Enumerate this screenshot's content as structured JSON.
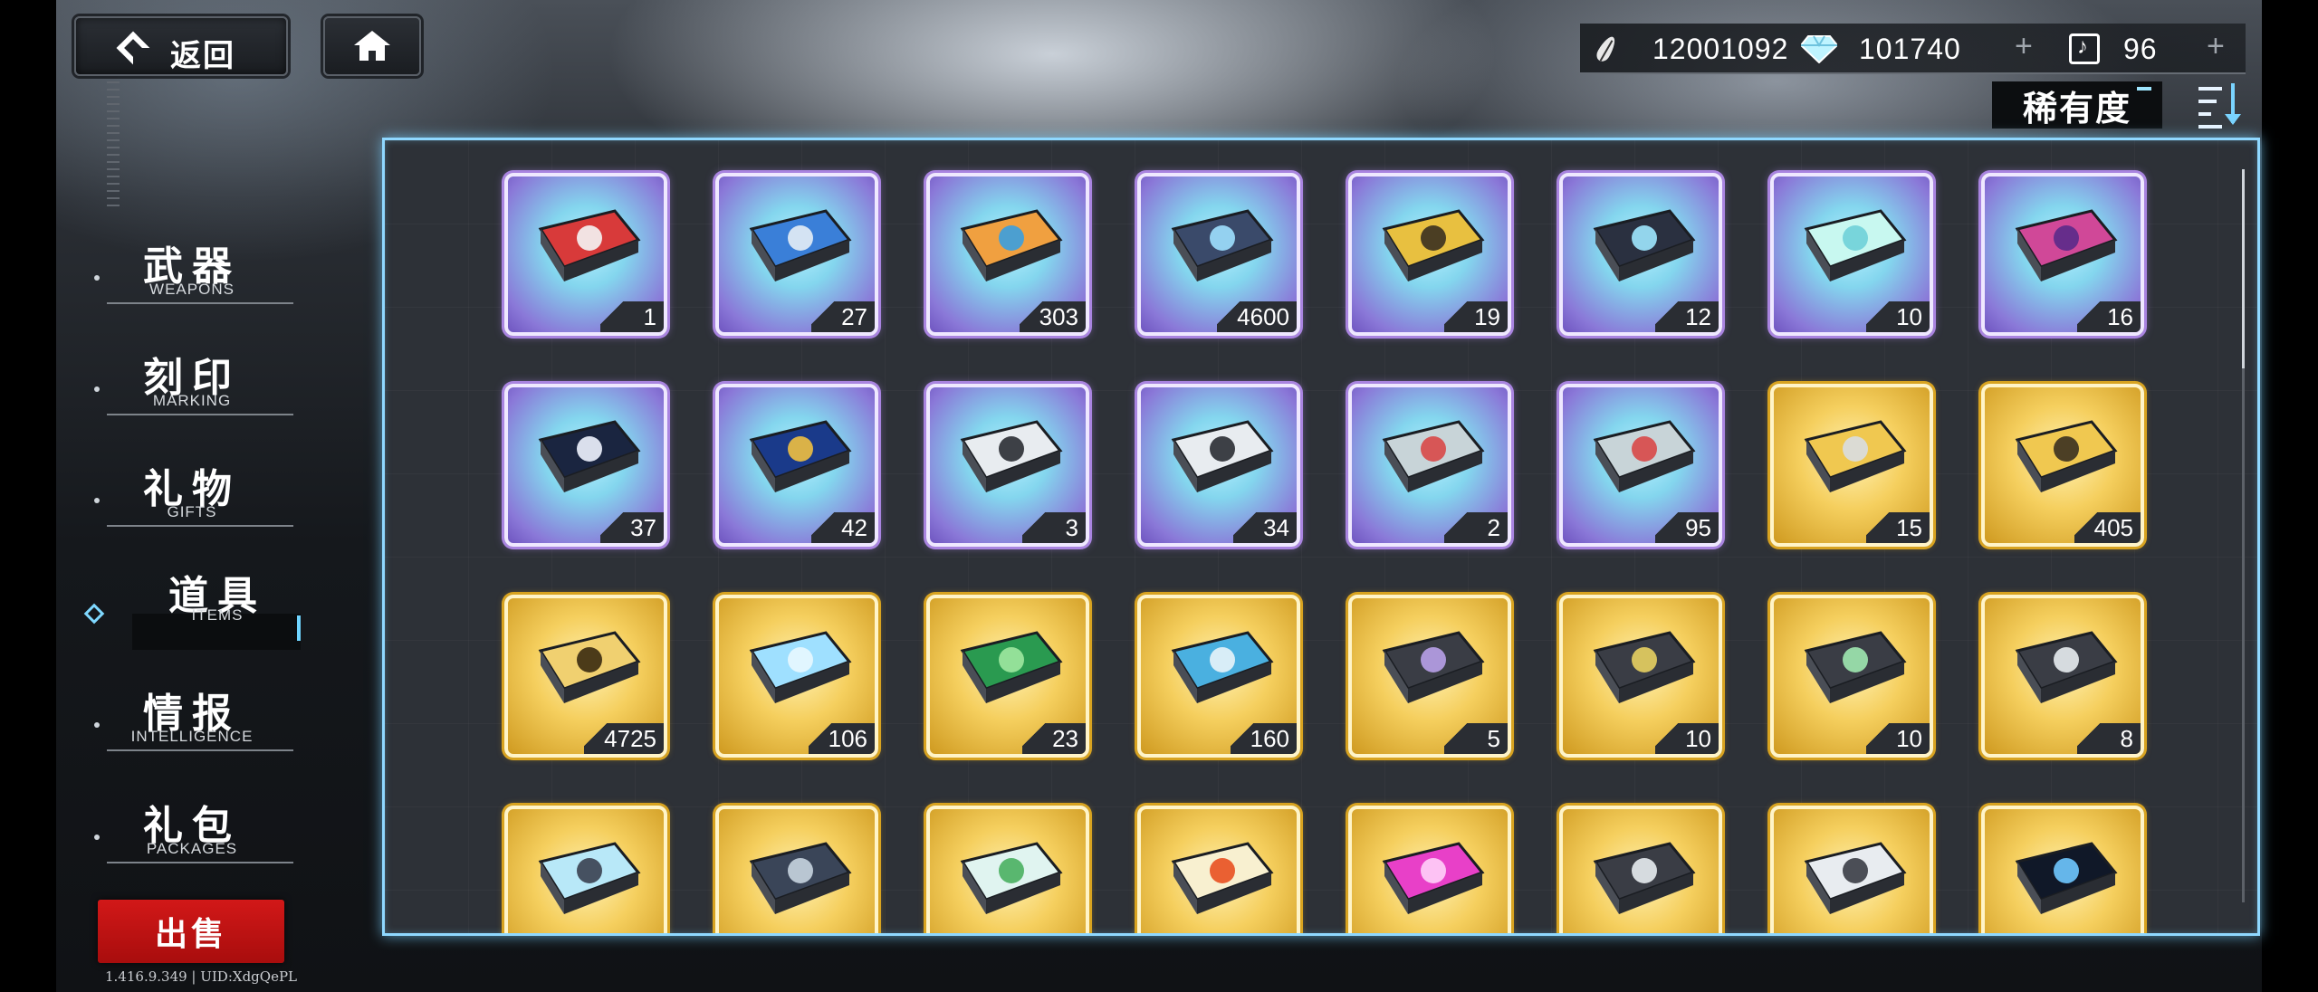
{
  "header": {
    "back_label": "返回",
    "home_icon": "home-icon"
  },
  "currency": {
    "feather": "12001092",
    "diamond": "101740",
    "ticket": "96",
    "plus": "+"
  },
  "sort": {
    "label": "稀有度",
    "icon": "sort-descending-icon"
  },
  "nav": [
    {
      "zh": "武器",
      "en": "WEAPONS"
    },
    {
      "zh": "刻印",
      "en": "MARKING"
    },
    {
      "zh": "礼物",
      "en": "GIFTS"
    },
    {
      "zh": "道具",
      "en": "ITEMS",
      "active": true
    },
    {
      "zh": "情报",
      "en": "INTELLIGENCE"
    },
    {
      "zh": "礼包",
      "en": "PACKAGES"
    }
  ],
  "sell_label": "出售",
  "version": "1.416.9.349 | UID:XdgQePL",
  "items": [
    {
      "icon": "red-card-device",
      "qty": "1",
      "rarity": "purple"
    },
    {
      "icon": "blue-card-device",
      "qty": "27",
      "rarity": "purple"
    },
    {
      "icon": "orange-blue-chip",
      "qty": "303",
      "rarity": "purple"
    },
    {
      "icon": "compass-map",
      "qty": "4600",
      "rarity": "purple"
    },
    {
      "icon": "gold-rune-coin",
      "qty": "19",
      "rarity": "purple"
    },
    {
      "icon": "energy-claw",
      "qty": "12",
      "rarity": "purple"
    },
    {
      "icon": "crystal-apple",
      "qty": "10",
      "rarity": "purple"
    },
    {
      "icon": "hex-core",
      "qty": "16",
      "rarity": "purple"
    },
    {
      "icon": "permit-ticket",
      "qty": "37",
      "rarity": "purple"
    },
    {
      "icon": "transfer-ticket",
      "qty": "42",
      "rarity": "purple"
    },
    {
      "icon": "target-ticket-x10",
      "qty": "3",
      "rarity": "purple"
    },
    {
      "icon": "target-ticket",
      "qty": "34",
      "rarity": "purple"
    },
    {
      "icon": "transfer-card-x10",
      "qty": "2",
      "rarity": "purple"
    },
    {
      "icon": "transfer-card",
      "qty": "95",
      "rarity": "purple"
    },
    {
      "icon": "gold-card-device",
      "qty": "15",
      "rarity": "gold"
    },
    {
      "icon": "gold-chip",
      "qty": "405",
      "rarity": "gold"
    },
    {
      "icon": "gold-compass-map",
      "qty": "4725",
      "rarity": "gold"
    },
    {
      "icon": "blue-crystal",
      "qty": "106",
      "rarity": "gold"
    },
    {
      "icon": "green-crystal",
      "qty": "23",
      "rarity": "gold"
    },
    {
      "icon": "blue-manual",
      "qty": "160",
      "rarity": "gold"
    },
    {
      "icon": "purple-module",
      "qty": "5",
      "rarity": "gold"
    },
    {
      "icon": "yellow-module",
      "qty": "10",
      "rarity": "gold"
    },
    {
      "icon": "green-module",
      "qty": "10",
      "rarity": "gold"
    },
    {
      "icon": "shield-module",
      "qty": "8",
      "rarity": "gold"
    },
    {
      "icon": "bottle",
      "qty": "",
      "rarity": "gold"
    },
    {
      "icon": "ore-rock",
      "qty": "",
      "rarity": "gold"
    },
    {
      "icon": "sprout-orb",
      "qty": "",
      "rarity": "gold"
    },
    {
      "icon": "test-tube",
      "qty": "",
      "rarity": "gold"
    },
    {
      "icon": "pink-energy",
      "qty": "",
      "rarity": "gold"
    },
    {
      "icon": "metal-shards",
      "qty": "",
      "rarity": "gold"
    },
    {
      "icon": "gadget",
      "qty": "",
      "rarity": "gold"
    },
    {
      "icon": "dark-cube",
      "qty": "",
      "rarity": "gold"
    }
  ]
}
